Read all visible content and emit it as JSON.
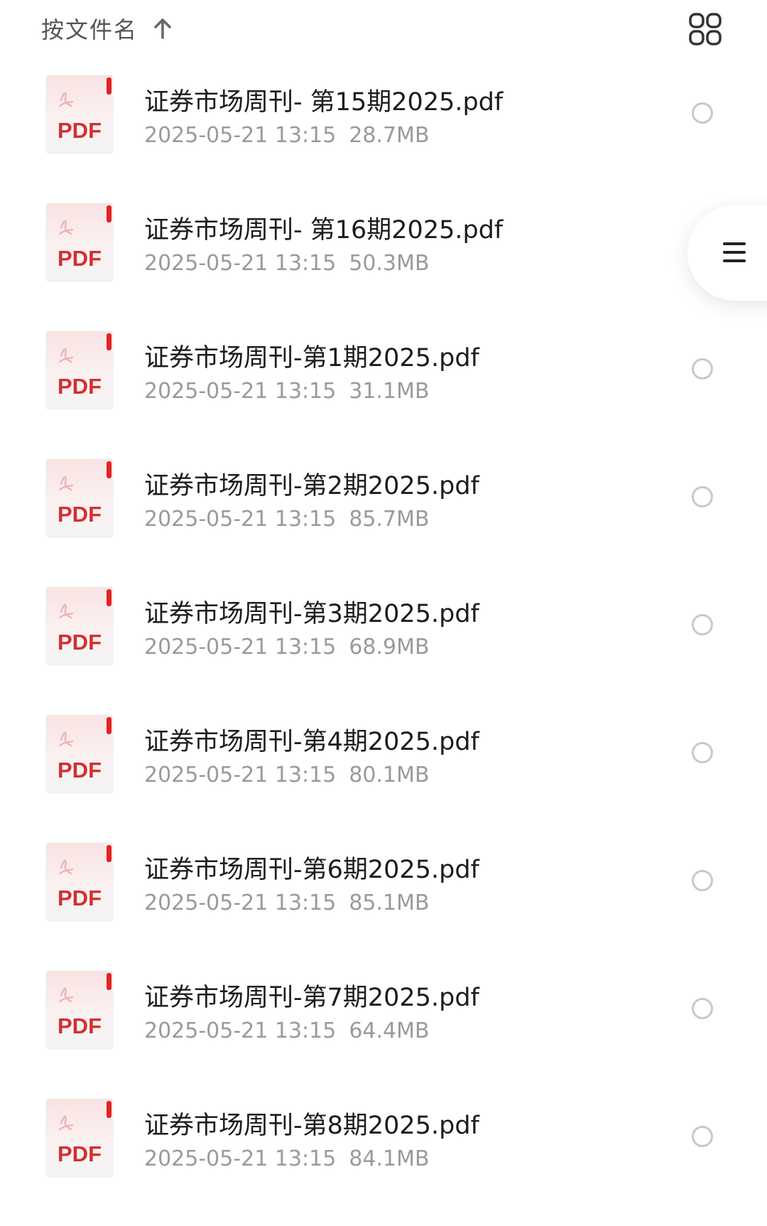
{
  "header": {
    "sort_label": "按文件名",
    "sort_direction_icon": "arrow-up-icon",
    "view_toggle_icon": "grid-view-icon"
  },
  "files": [
    {
      "name": "证券市场周刊- 第15期2025.pdf",
      "date": "2025-05-21 13:15",
      "size": "28.7MB",
      "icon": "pdf-file-icon",
      "icon_label": "PDF"
    },
    {
      "name": "证券市场周刊- 第16期2025.pdf",
      "date": "2025-05-21 13:15",
      "size": "50.3MB",
      "icon": "pdf-file-icon",
      "icon_label": "PDF"
    },
    {
      "name": "证券市场周刊-第1期2025.pdf",
      "date": "2025-05-21 13:15",
      "size": "31.1MB",
      "icon": "pdf-file-icon",
      "icon_label": "PDF"
    },
    {
      "name": "证券市场周刊-第2期2025.pdf",
      "date": "2025-05-21 13:15",
      "size": "85.7MB",
      "icon": "pdf-file-icon",
      "icon_label": "PDF"
    },
    {
      "name": "证券市场周刊-第3期2025.pdf",
      "date": "2025-05-21 13:15",
      "size": "68.9MB",
      "icon": "pdf-file-icon",
      "icon_label": "PDF"
    },
    {
      "name": "证券市场周刊-第4期2025.pdf",
      "date": "2025-05-21 13:15",
      "size": "80.1MB",
      "icon": "pdf-file-icon",
      "icon_label": "PDF"
    },
    {
      "name": "证券市场周刊-第6期2025.pdf",
      "date": "2025-05-21 13:15",
      "size": "85.1MB",
      "icon": "pdf-file-icon",
      "icon_label": "PDF"
    },
    {
      "name": "证券市场周刊-第7期2025.pdf",
      "date": "2025-05-21 13:15",
      "size": "64.4MB",
      "icon": "pdf-file-icon",
      "icon_label": "PDF"
    },
    {
      "name": "证券市场周刊-第8期2025.pdf",
      "date": "2025-05-21 13:15",
      "size": "84.1MB",
      "icon": "pdf-file-icon",
      "icon_label": "PDF"
    }
  ],
  "floating_menu": {
    "icon": "menu-icon"
  },
  "colors": {
    "pdf_red": "#d32f2f",
    "text_primary": "#1c1c1c",
    "text_secondary": "#9a9a9a",
    "radio_border": "#c8c8c8"
  }
}
